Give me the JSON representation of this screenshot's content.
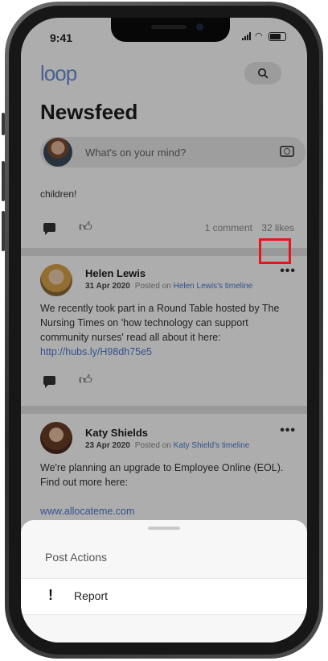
{
  "status_bar": {
    "time": "9:41"
  },
  "header": {
    "logo": "loop",
    "title": "Newsfeed"
  },
  "composer": {
    "placeholder": "What's on your mind?"
  },
  "previous_post": {
    "text_tail": "children!",
    "comments": "1 comment",
    "likes": "32 likes"
  },
  "posts": [
    {
      "author": "Helen Lewis",
      "date": "31 Apr 2020",
      "posted_on_prefix": "Posted on",
      "timeline": "Helen Lewis's timeline",
      "text": "We recently took part in a Round Table hosted by The Nursing Times on 'how technology can support community nurses' read all about it here: ",
      "link": "http://hubs.ly/H98dh75e5",
      "more": "•••"
    },
    {
      "author": "Katy Shields",
      "date": "23 Apr 2020",
      "posted_on_prefix": "Posted on",
      "timeline": "Katy Shield's timeline",
      "text": "We're planning an upgrade to Employee Online (EOL). Find out more here:",
      "link": "www.allocateme.com",
      "more": "•••"
    }
  ],
  "sheet": {
    "title": "Post Actions",
    "items": [
      {
        "label": "Report",
        "icon": "exclamation-icon"
      }
    ]
  },
  "colors": {
    "accent": "#4a7ad0",
    "highlight": "#e8141c"
  }
}
